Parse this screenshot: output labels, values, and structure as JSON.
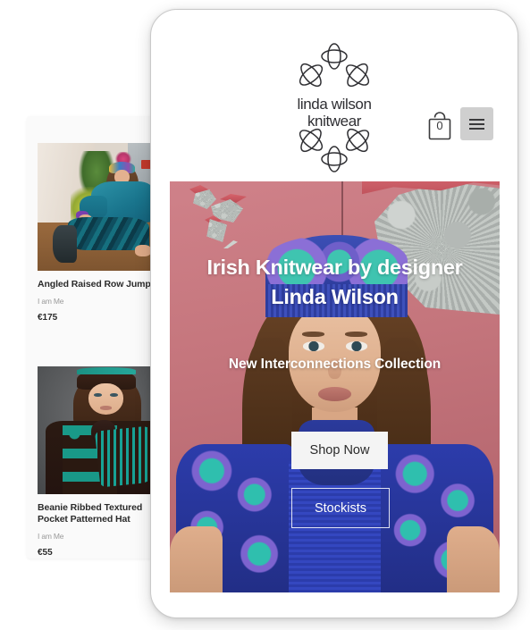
{
  "site": {
    "brand": {
      "logo_line_1": "linda wilson",
      "logo_line_2": "knitwear",
      "logo_icon": "floral-petal-emblem"
    },
    "header": {
      "cart_icon": "shopping-bag-icon",
      "cart_count": "0",
      "menu_icon": "hamburger-menu-icon"
    },
    "hero": {
      "headline": "Irish Knitwear by designer Linda Wilson",
      "subheadline": "New Interconnections Collection",
      "cta_primary": "Shop Now",
      "cta_secondary": "Stockists",
      "background_alt": "Model in blue patterned knitted hat, scarf and cardigan against pink peeling-paint metal wall"
    }
  },
  "product_list": {
    "items": [
      {
        "title": "Angled Raised Row Jumper",
        "vendor": "I am Me",
        "price": "€175",
        "image_alt": "Woman seated in teal knitted jumper and skirt beside plants"
      },
      {
        "title": "Beanie Ribbed Textured Pocket Patterned Hat",
        "vendor": "I am Me",
        "price": "€55",
        "image_alt": "Woman in teal and brown patterned knitwear with beanie and scarf"
      }
    ]
  },
  "colors": {
    "page_background": "#ffffff",
    "card_background": "#fafafa",
    "text_primary": "#2b2b2b",
    "text_muted": "#9a9a9a",
    "menu_button_background": "#cfcfcf",
    "cta_primary_background": "#f4f4f4",
    "hero_wall": "#c5767d",
    "device_border": "#c9c9c9"
  }
}
